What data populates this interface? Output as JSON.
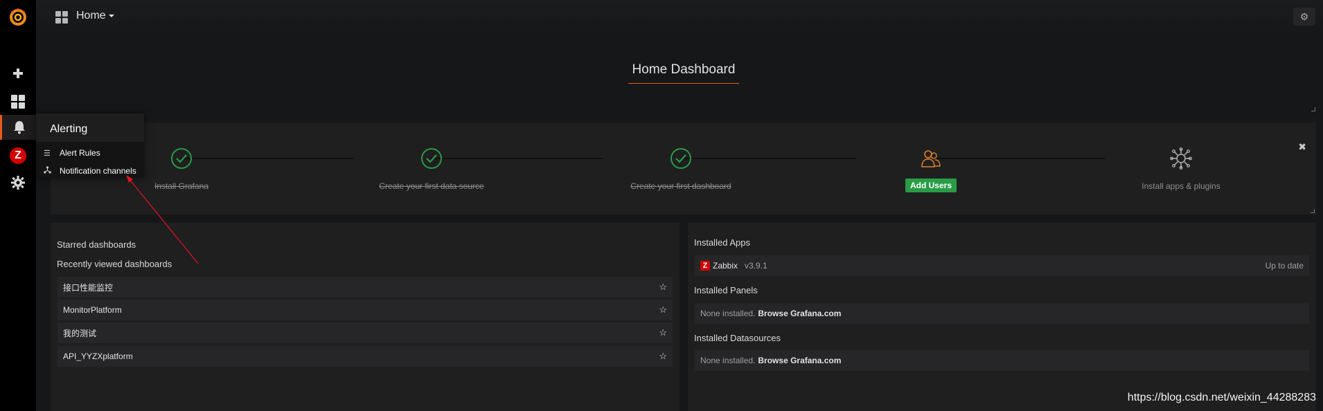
{
  "topbar": {
    "title": "Home"
  },
  "dashboard": {
    "title": "Home Dashboard"
  },
  "alert_menu": {
    "header": "Alerting",
    "items": [
      {
        "label": "Alert Rules",
        "icon": "list-icon"
      },
      {
        "label": "Notification channels",
        "icon": "share-icon"
      }
    ]
  },
  "getting_started": {
    "steps": [
      {
        "label": "Install Grafana",
        "done": true
      },
      {
        "label": "Create your first data source",
        "done": true
      },
      {
        "label": "Create your first dashboard",
        "done": true
      },
      {
        "label": "Add Users",
        "done": false,
        "is_button": true
      },
      {
        "label": "Install apps & plugins",
        "done": false
      }
    ]
  },
  "left_panel": {
    "starred_label": "Starred dashboards",
    "recent_label": "Recently viewed dashboards",
    "dashboards": [
      "接口性能监控",
      "MonitorPlatform",
      "我的测试",
      "API_YYZXplatform"
    ]
  },
  "right_panel": {
    "apps_label": "Installed Apps",
    "app": {
      "name": "Zabbix",
      "version": "v3.9.1",
      "status": "Up to date"
    },
    "panels_label": "Installed Panels",
    "panels_none": "None installed.",
    "panels_browse": "Browse Grafana.com",
    "datasources_label": "Installed Datasources",
    "datasources_none": "None installed.",
    "datasources_browse": "Browse Grafana.com"
  },
  "watermark": "https://blog.csdn.net/weixin_44288283",
  "colors": {
    "accent": "#e25a1c",
    "success": "#299c46",
    "zabbix": "#d40000"
  }
}
